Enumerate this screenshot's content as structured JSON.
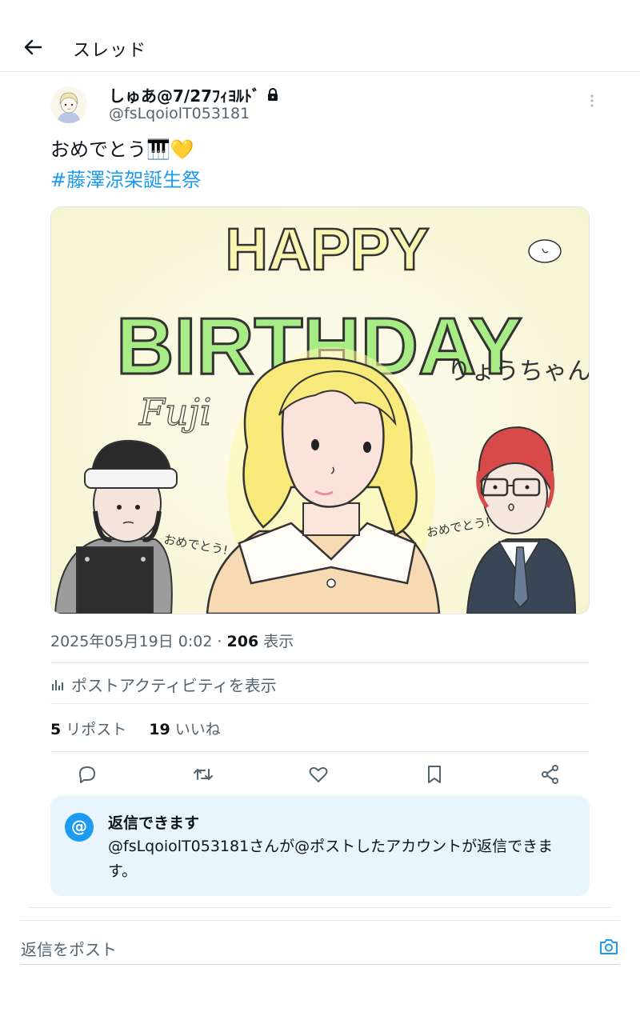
{
  "header": {
    "title": "スレッド"
  },
  "tweet": {
    "author_name": "しゅあ@7/27ﾌｨﾖﾙﾄﾞ",
    "handle": "@fsLqoiolT053181",
    "text": "おめでとう🎹💛",
    "hashtag": "#藤澤涼架誕生祭",
    "timestamp": "2025年05月19日 0:02 · ",
    "views_count": "206",
    "views_label": " 表示",
    "activity_label": "ポストアクティビティを表示",
    "reposts_count": "5",
    "reposts_label": " リポスト",
    "likes_count": "19",
    "likes_label": " いいね"
  },
  "media": {
    "happy": "HAPPY",
    "birthday": "BIRTHDAY",
    "name_tag": "りょうちゃん",
    "signature": "Fuji",
    "left_caption": "おめでとう!",
    "right_caption": "おめでとう!"
  },
  "reply_settings": {
    "icon": "@",
    "title": "返信できます",
    "description": "@fsLqoiolT053181さんが@ポストしたアカウントが返信できます。"
  },
  "composer": {
    "placeholder": "返信をポスト"
  },
  "icons": [
    "back-arrow-icon",
    "lock-icon",
    "more-vertical-icon",
    "stats-icon",
    "reply-icon",
    "repost-icon",
    "like-icon",
    "bookmark-icon",
    "share-icon",
    "camera-icon"
  ],
  "colors": {
    "accent": "#1d9bf0",
    "text": "#0f1419",
    "muted": "#536471",
    "reply_bg": "#e8f5fd"
  }
}
